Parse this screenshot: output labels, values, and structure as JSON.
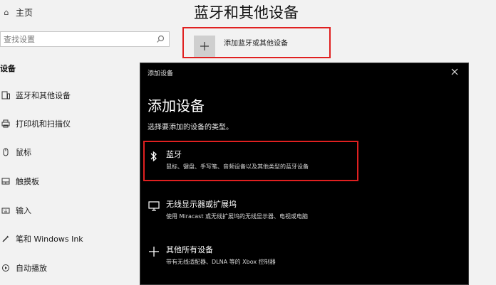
{
  "sidebar": {
    "home_label": "主页",
    "search_placeholder": "查找设置",
    "section_label": "设备",
    "items": [
      {
        "label": "蓝牙和其他设备",
        "icon": "device-icon"
      },
      {
        "label": "打印机和扫描仪",
        "icon": "printer-icon"
      },
      {
        "label": "鼠标",
        "icon": "mouse-icon"
      },
      {
        "label": "触摸板",
        "icon": "touchpad-icon"
      },
      {
        "label": "输入",
        "icon": "keyboard-icon"
      },
      {
        "label": "笔和 Windows Ink",
        "icon": "pen-icon"
      },
      {
        "label": "自动播放",
        "icon": "autoplay-icon"
      }
    ]
  },
  "main": {
    "title": "蓝牙和其他设备",
    "add_device_label": "添加蓝牙或其他设备"
  },
  "dialog": {
    "window_title": "添加设备",
    "heading": "添加设备",
    "subtitle": "选择要添加的设备的类型。",
    "options": [
      {
        "title": "蓝牙",
        "desc": "鼠标、键盘、手写笔、音频设备以及其他类型的蓝牙设备",
        "icon": "bluetooth-icon"
      },
      {
        "title": "无线显示器或扩展坞",
        "desc": "使用 Miracast 或无线扩展坞的无线显示器、电视或电脑",
        "icon": "monitor-icon"
      },
      {
        "title": "其他所有设备",
        "desc": "带有无线适配器、DLNA 等的 Xbox 控制器",
        "icon": "plus-icon"
      }
    ]
  },
  "colors": {
    "highlight": "#e02020",
    "dialog_bg": "#000000",
    "page_bg": "#f2f2f2"
  }
}
